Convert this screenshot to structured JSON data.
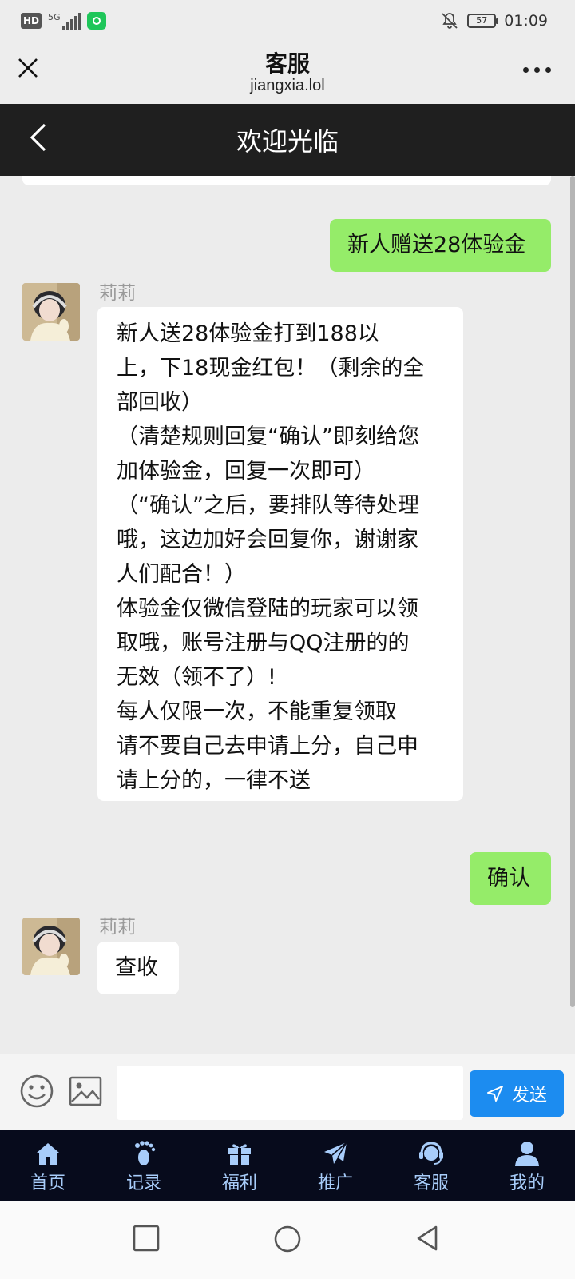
{
  "status_bar": {
    "hd": "HD",
    "network": "5G",
    "battery": "57",
    "time": "01:09"
  },
  "wechat_bar": {
    "title": "客服",
    "domain": "jiangxia.lol"
  },
  "page": {
    "title": "欢迎光临"
  },
  "messages": [
    {
      "from": "me",
      "text": "新人赠送28体验金"
    },
    {
      "from": "them",
      "sender": "莉莉",
      "text": "  新人送28体验金打到188以\n上，下18现金红包！（剩余的全\n部回收）\n（清楚规则回复“确认”即刻给您\n加体验金，回复一次即可）\n（“确认”之后，要排队等待处理\n哦，这边加好会回复你，谢谢家\n人们配合！）\n体验金仅微信登陆的玩家可以领\n取哦，账号注册与QQ注册的的\n无效（领不了）!\n每人仅限一次，不能重复领取\n请不要自己去申请上分，自己申\n请上分的，一律不送"
    },
    {
      "from": "me",
      "text": "确认"
    },
    {
      "from": "them",
      "sender": "莉莉",
      "text": "查收"
    }
  ],
  "input": {
    "value": "",
    "send_label": "发送"
  },
  "tabs": [
    {
      "label": "首页",
      "icon": "home-icon"
    },
    {
      "label": "记录",
      "icon": "footprint-icon"
    },
    {
      "label": "福利",
      "icon": "gift-icon"
    },
    {
      "label": "推广",
      "icon": "paper-plane-icon"
    },
    {
      "label": "客服",
      "icon": "headset-icon"
    },
    {
      "label": "我的",
      "icon": "user-icon"
    }
  ],
  "colors": {
    "header_bg": "#1f1f1f",
    "my_bubble": "#95ec69",
    "send_button": "#1c8cf0",
    "tabbar_bg": "#070b1c"
  }
}
